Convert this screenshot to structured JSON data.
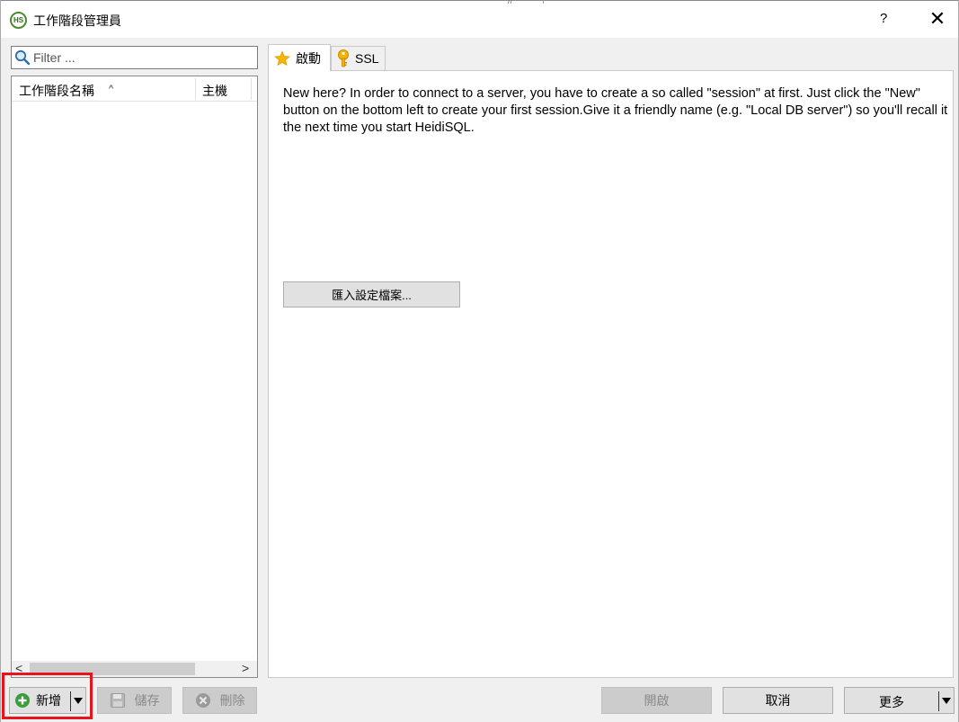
{
  "window": {
    "title": "工作階段管理員",
    "help_label": "?",
    "close_label": "✕",
    "grip": "//"
  },
  "filter": {
    "placeholder": "Filter ..."
  },
  "session_list": {
    "columns": [
      {
        "label": "工作階段名稱",
        "sort": "ascending"
      },
      {
        "label": "主機"
      }
    ],
    "sort_indicator": "^",
    "scroll_left": "<",
    "scroll_right": ">",
    "rows": []
  },
  "tabs": [
    {
      "label": "啟動",
      "icon": "star-icon",
      "active": true
    },
    {
      "label": "SSL",
      "icon": "key-icon",
      "active": false
    }
  ],
  "start_panel": {
    "intro_text": "New here? In order to connect to a server, you have to create a so called \"session\" at first. Just click the \"New\" button on the bottom left to create your first session.Give it a friendly name (e.g. \"Local DB server\") so you'll recall it the next time you start HeidiSQL.",
    "import_button_label": "匯入設定檔案..."
  },
  "footer": {
    "new_label": "新增",
    "save_label": "儲存",
    "delete_label": "刪除",
    "open_label": "開啟",
    "cancel_label": "取消",
    "more_label": "更多"
  },
  "colors": {
    "highlight": "#e8131b",
    "new_icon": "#3b9c3b",
    "star": "#f7b500",
    "key": "#e8a200"
  }
}
